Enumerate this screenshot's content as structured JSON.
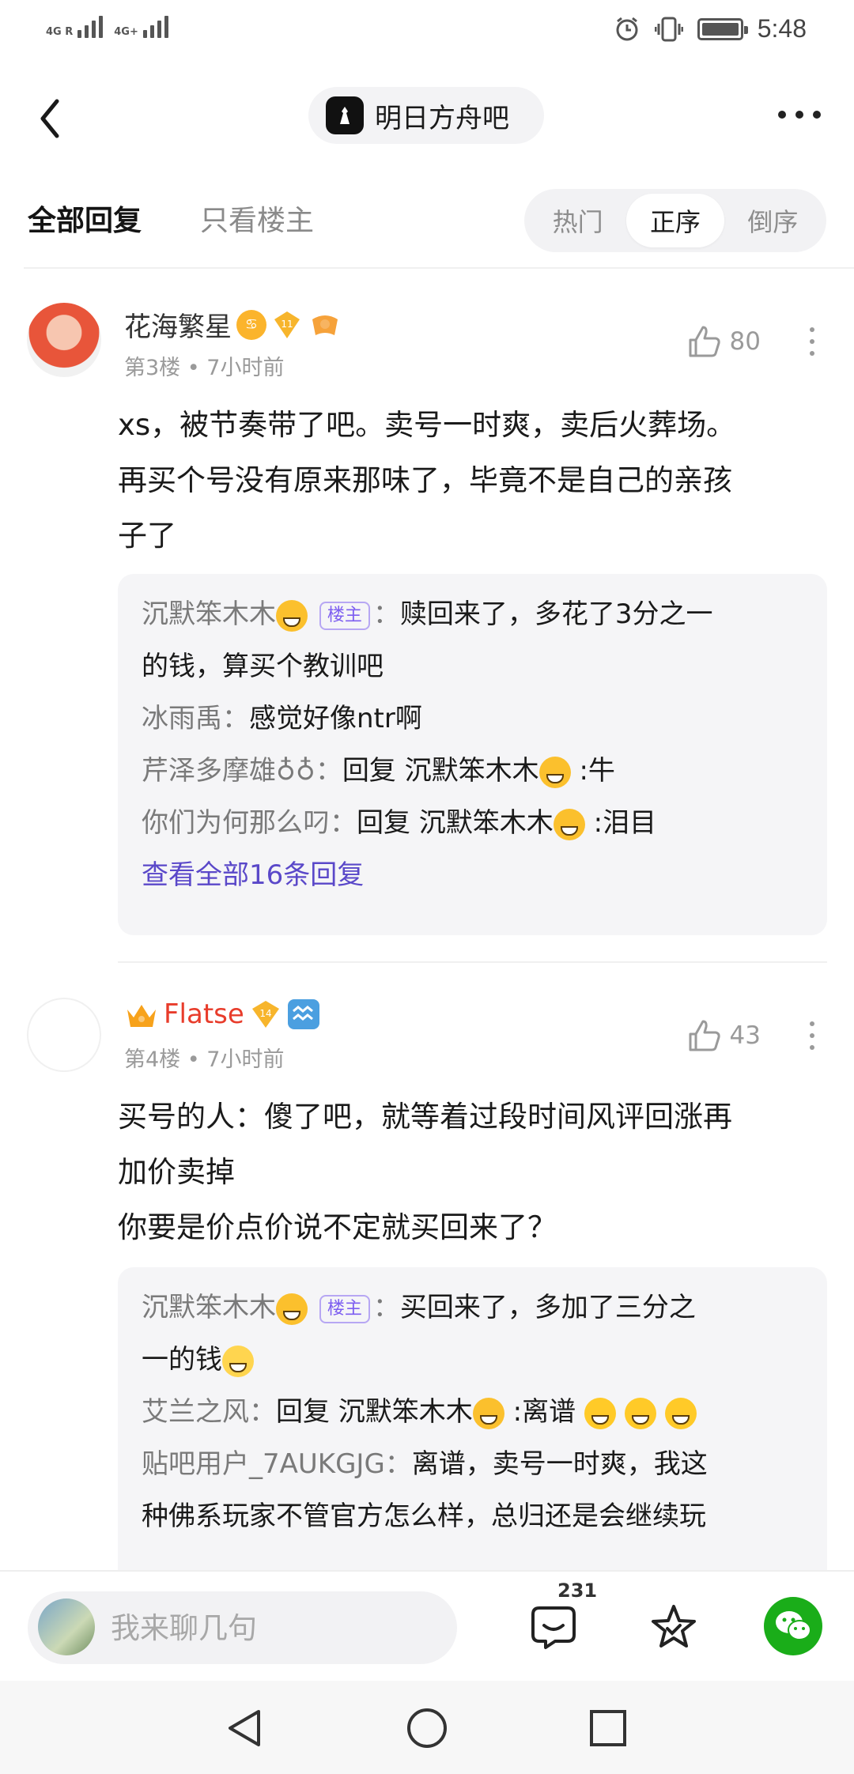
{
  "status_bar": {
    "signal1_label": "4G R",
    "signal2_label": "4G+",
    "time": "5:48"
  },
  "header": {
    "forum_name": "明日方舟吧"
  },
  "tabs": {
    "all_replies": "全部回复",
    "owner_only": "只看楼主",
    "sort_options": [
      "热门",
      "正序",
      "倒序"
    ],
    "active_sort": "正序"
  },
  "posts": [
    {
      "username": "花海繁星",
      "level": "11",
      "floor": "第3楼",
      "time": "7小时前",
      "likes": "80",
      "body_lines": [
        "xs，被节奏带了吧。卖号一时爽，卖后火葬场。",
        "再买个号没有原来那味了，毕竟不是自己的亲孩",
        "子了"
      ],
      "replies": [
        {
          "name": "沉默笨木木",
          "owner": true,
          "text_line1": "赎回来了，多花了3分之一",
          "text_line2": "的钱，算买个教训吧"
        },
        {
          "name": "冰雨禹",
          "text": "感觉好像ntr啊"
        },
        {
          "name": "芹泽多摩雄♁♁",
          "text_prefix": "回复 沉默笨木木",
          "text_suffix": ":牛"
        },
        {
          "name": "你们为何那么叼",
          "text_prefix": "回复 沉默笨木木",
          "text_suffix": ":泪目"
        }
      ],
      "view_all": "查看全部16条回复"
    },
    {
      "username": "Flatse",
      "level": "14",
      "floor": "第4楼",
      "time": "7小时前",
      "likes": "43",
      "body_lines": [
        "买号的人：傻了吧，就等着过段时间风评回涨再",
        "加价卖掉",
        "你要是价点价说不定就买回来了？"
      ],
      "replies": [
        {
          "name": "沉默笨木木",
          "owner": true,
          "text_line1": "买回来了，多加了三分之",
          "text_line2": "一的钱"
        },
        {
          "name": "艾兰之风",
          "text_prefix": "回复 沉默笨木木",
          "text_suffix": ":离谱"
        },
        {
          "name": "贴吧用户_7AUKGJG",
          "text_line1": "离谱，卖号一时爽，我这",
          "text_line2": "种佛系玩家不管官方怎么样，总归还是会继续玩"
        }
      ]
    }
  ],
  "owner_badge": "楼主",
  "separator": "：",
  "bottom_bar": {
    "input_placeholder": "我来聊几句",
    "comment_count": "231"
  },
  "colors": {
    "accent_purple": "#5a48c9",
    "vip_red": "#e83c2b",
    "wechat_green": "#1aad19"
  }
}
